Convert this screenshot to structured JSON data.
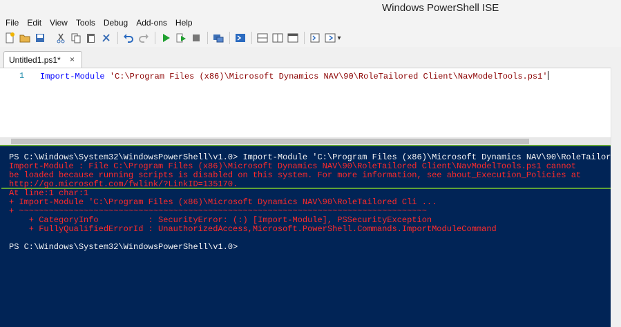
{
  "window": {
    "title": "Windows PowerShell ISE"
  },
  "menu": [
    "File",
    "Edit",
    "View",
    "Tools",
    "Debug",
    "Add-ons",
    "Help"
  ],
  "toolbar": {
    "icons": [
      "new-icon",
      "open-icon",
      "save-icon",
      "cut-icon",
      "copy-icon",
      "paste-icon",
      "clear-icon",
      "undo-icon",
      "redo-icon",
      "run-icon",
      "run-selection-icon",
      "stop-icon",
      "remote-icon",
      "powershell-icon",
      "layout-top-icon",
      "layout-right-icon",
      "layout-max-icon",
      "commands-icon",
      "addon-icon",
      "overflow-icon"
    ]
  },
  "tabs": [
    {
      "label": "Untitled1.ps1*",
      "close": "×"
    }
  ],
  "editor": {
    "line_number": "1",
    "keyword": "Import-Module",
    "argument": "'C:\\Program Files (x86)\\Microsoft Dynamics NAV\\90\\RoleTailored Client\\NavModelTools.ps1'"
  },
  "console": {
    "prompt_line": "PS C:\\Windows\\System32\\WindowsPowerShell\\v1.0> Import-Module 'C:\\Program Files (x86)\\Microsoft Dynamics NAV\\90\\RoleTailor",
    "error_lines": [
      "Import-Module : File C:\\Program Files (x86)\\Microsoft Dynamics NAV\\90\\RoleTailored Client\\NavModelTools.ps1 cannot",
      "be loaded because running scripts is disabled on this system. For more information, see about_Execution_Policies at",
      "http://go.microsoft.com/fwlink/?LinkID=135170.",
      "At line:1 char:1",
      "+ Import-Module 'C:\\Program Files (x86)\\Microsoft Dynamics NAV\\90\\RoleTailored Cli ...",
      "+ ~~~~~~~~~~~~~~~~~~~~~~~~~~~~~~~~~~~~~~~~~~~~~~~~~~~~~~~~~~~~~~~~~~~~~~~~~~~~~~~~~~",
      "    + CategoryInfo          : SecurityError: (:) [Import-Module], PSSecurityException",
      "    + FullyQualifiedErrorId : UnauthorizedAccess,Microsoft.PowerShell.Commands.ImportModuleCommand"
    ],
    "final_prompt": "PS C:\\Windows\\System32\\WindowsPowerShell\\v1.0>"
  },
  "colors": {
    "console_bg": "#012456",
    "error": "#ff2b2b",
    "highlight": "#5fa336"
  }
}
